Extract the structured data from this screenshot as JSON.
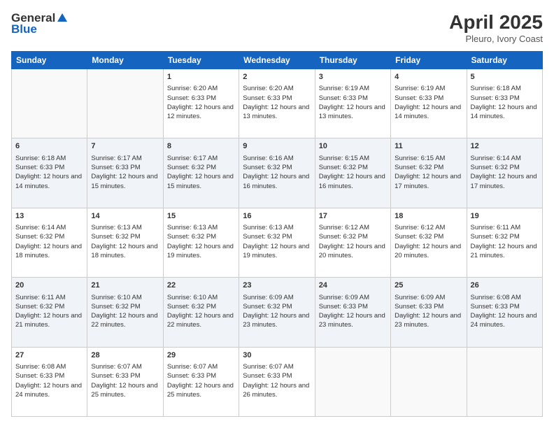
{
  "header": {
    "logo_general": "General",
    "logo_blue": "Blue",
    "month_title": "April 2025",
    "location": "Pleuro, Ivory Coast"
  },
  "days_of_week": [
    "Sunday",
    "Monday",
    "Tuesday",
    "Wednesday",
    "Thursday",
    "Friday",
    "Saturday"
  ],
  "weeks": [
    [
      {
        "day": "",
        "info": ""
      },
      {
        "day": "",
        "info": ""
      },
      {
        "day": "1",
        "info": "Sunrise: 6:20 AM\nSunset: 6:33 PM\nDaylight: 12 hours and 12 minutes."
      },
      {
        "day": "2",
        "info": "Sunrise: 6:20 AM\nSunset: 6:33 PM\nDaylight: 12 hours and 13 minutes."
      },
      {
        "day": "3",
        "info": "Sunrise: 6:19 AM\nSunset: 6:33 PM\nDaylight: 12 hours and 13 minutes."
      },
      {
        "day": "4",
        "info": "Sunrise: 6:19 AM\nSunset: 6:33 PM\nDaylight: 12 hours and 14 minutes."
      },
      {
        "day": "5",
        "info": "Sunrise: 6:18 AM\nSunset: 6:33 PM\nDaylight: 12 hours and 14 minutes."
      }
    ],
    [
      {
        "day": "6",
        "info": "Sunrise: 6:18 AM\nSunset: 6:33 PM\nDaylight: 12 hours and 14 minutes."
      },
      {
        "day": "7",
        "info": "Sunrise: 6:17 AM\nSunset: 6:33 PM\nDaylight: 12 hours and 15 minutes."
      },
      {
        "day": "8",
        "info": "Sunrise: 6:17 AM\nSunset: 6:32 PM\nDaylight: 12 hours and 15 minutes."
      },
      {
        "day": "9",
        "info": "Sunrise: 6:16 AM\nSunset: 6:32 PM\nDaylight: 12 hours and 16 minutes."
      },
      {
        "day": "10",
        "info": "Sunrise: 6:15 AM\nSunset: 6:32 PM\nDaylight: 12 hours and 16 minutes."
      },
      {
        "day": "11",
        "info": "Sunrise: 6:15 AM\nSunset: 6:32 PM\nDaylight: 12 hours and 17 minutes."
      },
      {
        "day": "12",
        "info": "Sunrise: 6:14 AM\nSunset: 6:32 PM\nDaylight: 12 hours and 17 minutes."
      }
    ],
    [
      {
        "day": "13",
        "info": "Sunrise: 6:14 AM\nSunset: 6:32 PM\nDaylight: 12 hours and 18 minutes."
      },
      {
        "day": "14",
        "info": "Sunrise: 6:13 AM\nSunset: 6:32 PM\nDaylight: 12 hours and 18 minutes."
      },
      {
        "day": "15",
        "info": "Sunrise: 6:13 AM\nSunset: 6:32 PM\nDaylight: 12 hours and 19 minutes."
      },
      {
        "day": "16",
        "info": "Sunrise: 6:13 AM\nSunset: 6:32 PM\nDaylight: 12 hours and 19 minutes."
      },
      {
        "day": "17",
        "info": "Sunrise: 6:12 AM\nSunset: 6:32 PM\nDaylight: 12 hours and 20 minutes."
      },
      {
        "day": "18",
        "info": "Sunrise: 6:12 AM\nSunset: 6:32 PM\nDaylight: 12 hours and 20 minutes."
      },
      {
        "day": "19",
        "info": "Sunrise: 6:11 AM\nSunset: 6:32 PM\nDaylight: 12 hours and 21 minutes."
      }
    ],
    [
      {
        "day": "20",
        "info": "Sunrise: 6:11 AM\nSunset: 6:32 PM\nDaylight: 12 hours and 21 minutes."
      },
      {
        "day": "21",
        "info": "Sunrise: 6:10 AM\nSunset: 6:32 PM\nDaylight: 12 hours and 22 minutes."
      },
      {
        "day": "22",
        "info": "Sunrise: 6:10 AM\nSunset: 6:32 PM\nDaylight: 12 hours and 22 minutes."
      },
      {
        "day": "23",
        "info": "Sunrise: 6:09 AM\nSunset: 6:32 PM\nDaylight: 12 hours and 23 minutes."
      },
      {
        "day": "24",
        "info": "Sunrise: 6:09 AM\nSunset: 6:33 PM\nDaylight: 12 hours and 23 minutes."
      },
      {
        "day": "25",
        "info": "Sunrise: 6:09 AM\nSunset: 6:33 PM\nDaylight: 12 hours and 23 minutes."
      },
      {
        "day": "26",
        "info": "Sunrise: 6:08 AM\nSunset: 6:33 PM\nDaylight: 12 hours and 24 minutes."
      }
    ],
    [
      {
        "day": "27",
        "info": "Sunrise: 6:08 AM\nSunset: 6:33 PM\nDaylight: 12 hours and 24 minutes."
      },
      {
        "day": "28",
        "info": "Sunrise: 6:07 AM\nSunset: 6:33 PM\nDaylight: 12 hours and 25 minutes."
      },
      {
        "day": "29",
        "info": "Sunrise: 6:07 AM\nSunset: 6:33 PM\nDaylight: 12 hours and 25 minutes."
      },
      {
        "day": "30",
        "info": "Sunrise: 6:07 AM\nSunset: 6:33 PM\nDaylight: 12 hours and 26 minutes."
      },
      {
        "day": "",
        "info": ""
      },
      {
        "day": "",
        "info": ""
      },
      {
        "day": "",
        "info": ""
      }
    ]
  ]
}
